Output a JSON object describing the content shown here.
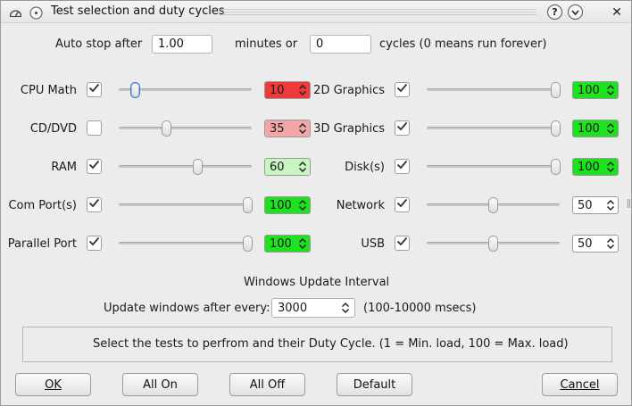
{
  "window": {
    "title": "Test selection and duty cycles",
    "help_glyph": "?",
    "close_glyph": "✕"
  },
  "autostop": {
    "label": "Auto stop after",
    "minutes_value": "1.00",
    "minutes_label": "minutes or",
    "cycles_value": "0",
    "cycles_label": "cycles (0 means run forever)"
  },
  "tests_left": [
    {
      "label": "CPU Math",
      "checked": true,
      "duty": 10,
      "spin_color": "#f03a3a"
    },
    {
      "label": "CD/DVD",
      "checked": false,
      "duty": 35,
      "spin_color": "#f4a6a6"
    },
    {
      "label": "RAM",
      "checked": true,
      "duty": 60,
      "spin_color": "#c8f5c2"
    },
    {
      "label": "Com Port(s)",
      "checked": true,
      "duty": 100,
      "spin_color": "#1ee21e"
    },
    {
      "label": "Parallel Port",
      "checked": true,
      "duty": 100,
      "spin_color": "#1ee21e"
    }
  ],
  "tests_right": [
    {
      "label": "2D Graphics",
      "checked": true,
      "duty": 100,
      "spin_color": "#1ee21e"
    },
    {
      "label": "3D Graphics",
      "checked": true,
      "duty": 100,
      "spin_color": "#1ee21e"
    },
    {
      "label": "Disk(s)",
      "checked": true,
      "duty": 100,
      "spin_color": "#1ee21e"
    },
    {
      "label": "Network",
      "checked": true,
      "duty": 50,
      "spin_color": "#ffffff"
    },
    {
      "label": "USB",
      "checked": true,
      "duty": 50,
      "spin_color": "#ffffff"
    }
  ],
  "update": {
    "heading": "Windows Update Interval",
    "label": "Update windows after every:",
    "value": "3000",
    "range_label": "(100-10000 msecs)"
  },
  "info_text": "Select the tests to perfrom and their Duty Cycle. (1 = Min. load, 100 = Max. load)",
  "buttons": {
    "ok": "OK",
    "all_on": "All On",
    "all_off": "All Off",
    "default": "Default",
    "cancel": "Cancel"
  }
}
